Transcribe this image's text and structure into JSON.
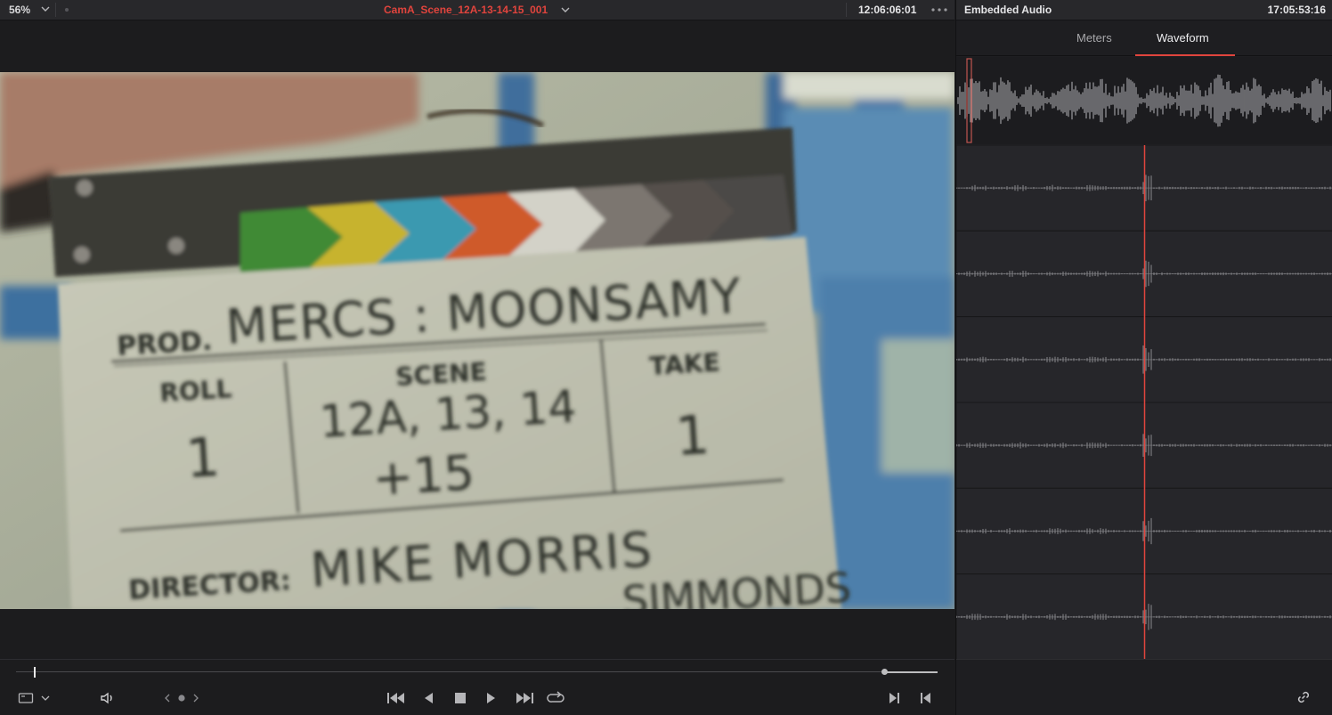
{
  "viewer": {
    "zoom": "56%",
    "clip_name": "CamA_Scene_12A-13-14-15_001",
    "timecode": "12:06:06:01",
    "playhead_fraction": 0.02,
    "slate": {
      "prod_label": "PROD.",
      "prod_value": "MERCS : MOONSAMY",
      "roll_label": "ROLL",
      "roll_value": "1",
      "scene_label": "SCENE",
      "scene_value_line1": "12A, 13, 14",
      "scene_value_line2": "+15",
      "take_label": "TAKE",
      "take_value": "1",
      "director_label": "DIRECTOR:",
      "director_value": "MIKE MORRIS",
      "dop_partial": "SIMMONDS"
    },
    "transport_icons": [
      "frame-view-icon",
      "chevron-down-icon",
      "volume-icon",
      "prev-edit-icon",
      "dot-icon",
      "next-edit-icon",
      "jump-to-start-icon",
      "play-reverse-icon",
      "stop-icon",
      "play-icon",
      "jump-to-end-icon",
      "loop-icon",
      "mark-in-icon",
      "mark-out-icon"
    ]
  },
  "audio": {
    "title": "Embedded Audio",
    "timecode": "17:05:53:16",
    "tabs": [
      {
        "label": "Meters",
        "active": false
      },
      {
        "label": "Waveform",
        "active": true
      }
    ],
    "channels": 6,
    "accent_color": "#e0443d"
  }
}
